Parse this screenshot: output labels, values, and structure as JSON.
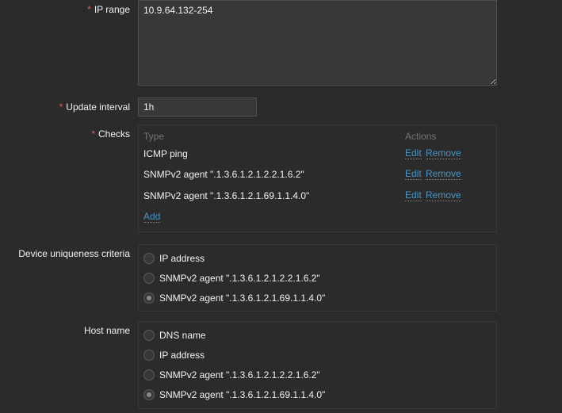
{
  "ip_range": {
    "label": "IP range",
    "required": "*",
    "value": "10.9.64.132-254"
  },
  "update_interval": {
    "label": "Update interval",
    "required": "*",
    "value": "1h"
  },
  "checks": {
    "label": "Checks",
    "required": "*",
    "header_type": "Type",
    "header_actions": "Actions",
    "rows": [
      {
        "type": "ICMP ping",
        "edit": "Edit",
        "remove": "Remove"
      },
      {
        "type": "SNMPv2 agent \".1.3.6.1.2.1.2.2.1.6.2\"",
        "edit": "Edit",
        "remove": "Remove"
      },
      {
        "type": "SNMPv2 agent \".1.3.6.1.2.1.69.1.1.4.0\"",
        "edit": "Edit",
        "remove": "Remove"
      }
    ],
    "add_label": "Add"
  },
  "device_uniqueness": {
    "label": "Device uniqueness criteria",
    "options": [
      {
        "label": "IP address",
        "checked": false
      },
      {
        "label": "SNMPv2 agent \".1.3.6.1.2.1.2.2.1.6.2\"",
        "checked": false
      },
      {
        "label": "SNMPv2 agent \".1.3.6.1.2.1.69.1.1.4.0\"",
        "checked": true
      }
    ]
  },
  "host_name": {
    "label": "Host name",
    "options": [
      {
        "label": "DNS name",
        "checked": false
      },
      {
        "label": "IP address",
        "checked": false
      },
      {
        "label": "SNMPv2 agent \".1.3.6.1.2.1.2.2.1.6.2\"",
        "checked": false
      },
      {
        "label": "SNMPv2 agent \".1.3.6.1.2.1.69.1.1.4.0\"",
        "checked": true
      }
    ]
  }
}
